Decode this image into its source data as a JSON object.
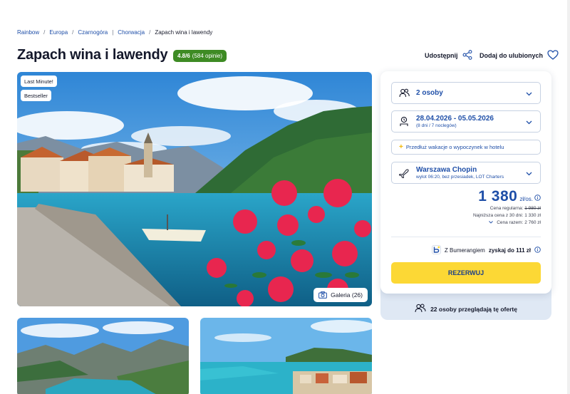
{
  "breadcrumb": {
    "items": [
      "Rainbow",
      "Europa",
      "Czarnogóra",
      "Chorwacja"
    ],
    "separators": [
      "/",
      "/",
      "|",
      "/"
    ],
    "current": "Zapach wina i lawendy"
  },
  "offer": {
    "title": "Zapach wina i lawendy",
    "rating": "4.8/6",
    "reviews": "(584 opinie)"
  },
  "actions": {
    "share_label": "Udostępnij",
    "favorite_label": "Dodaj do ulubionych"
  },
  "hero": {
    "badges": [
      "Last Minute!",
      "Bestseller"
    ],
    "gallery_label": "Galeria (26)"
  },
  "booking": {
    "persons": "2 osoby",
    "dates": "28.04.2026 - 05.05.2026",
    "duration": "(8 dni / 7 noclegów)",
    "extend_label": "Przedłuż wakacje o wypoczynek w hotelu",
    "departure_city": "Warszawa Chopin",
    "flight_info": "wylot 06:20, bez przesiadek, LOT Charters",
    "price": "1 380",
    "currency": "zł/os.",
    "regular_label": "Cena regularna:",
    "regular_price": "1 980 zł",
    "lowest_label": "Najniższa cena z 30 dni:",
    "lowest_price": "1 330 zł",
    "total_label": "Cena razem:",
    "total_price": "2 760 zł",
    "boomerang_prefix": "Z Bumerangiem",
    "boomerang_bold": "zyskaj do 111 zł",
    "reserve_label": "REZERWUJ",
    "viewers": "22 osoby przeglądają tę ofertę"
  },
  "colors": {
    "brand_blue": "#1f4fa8",
    "rating_green": "#3e8b24",
    "reserve_yellow": "#fcd835"
  },
  "icons": [
    "share-icon",
    "heart-icon",
    "camera-icon",
    "persons-icon",
    "calendar-icon",
    "plane-icon",
    "chevron-down-icon",
    "info-icon",
    "boomerang-icon",
    "viewers-icon"
  ]
}
